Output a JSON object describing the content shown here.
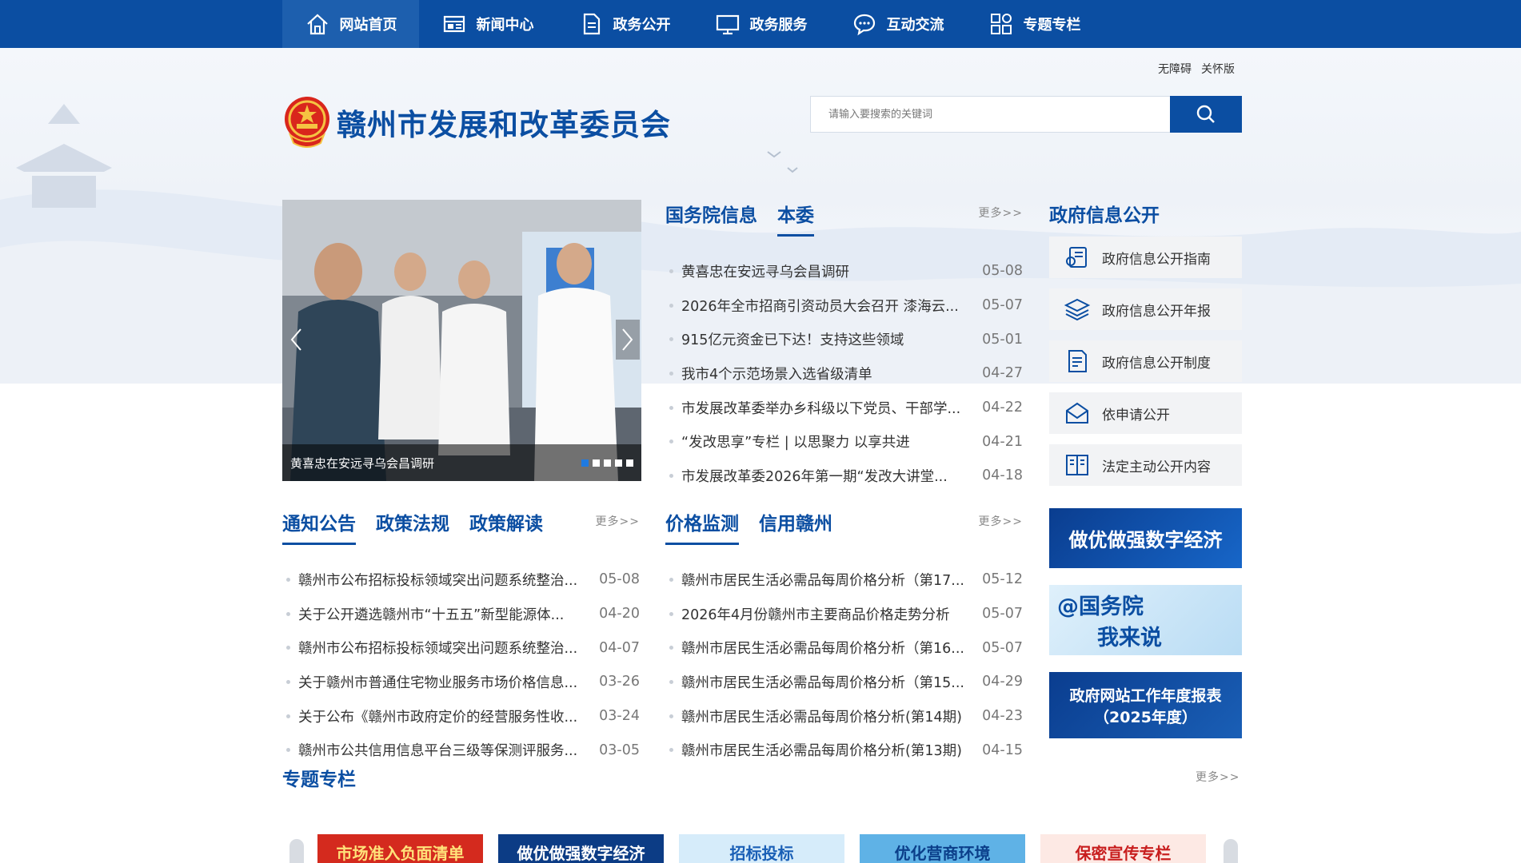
{
  "nav": {
    "items": [
      {
        "label": "网站首页",
        "icon": "home-icon"
      },
      {
        "label": "新闻中心",
        "icon": "newspaper-icon"
      },
      {
        "label": "政务公开",
        "icon": "document-icon"
      },
      {
        "label": "政务服务",
        "icon": "monitor-icon"
      },
      {
        "label": "互动交流",
        "icon": "chat-icon"
      },
      {
        "label": "专题专栏",
        "icon": "grid-icon"
      }
    ],
    "active_index": 0
  },
  "util": {
    "accessibility": "无障碍",
    "elderly": "关怀版"
  },
  "site": {
    "title": "赣州市发展和改革委员会"
  },
  "search": {
    "placeholder": "请输入要搜索的关键词"
  },
  "carousel": {
    "caption": "黄喜忠在安远寻乌会昌调研",
    "dot_count": 5,
    "active_dot": 0
  },
  "news1": {
    "tabs": [
      "国务院信息",
      "本委"
    ],
    "active_tab": 1,
    "more": "更多>>",
    "items": [
      {
        "title": "黄喜忠在安远寻乌会昌调研",
        "date": "05-08"
      },
      {
        "title": "2026年全市招商引资动员大会召开 漆海云...",
        "date": "05-07"
      },
      {
        "title": "915亿元资金已下达！支持这些领域",
        "date": "05-01"
      },
      {
        "title": "我市4个示范场景入选省级清单",
        "date": "04-27"
      },
      {
        "title": "市发展改革委举办乡科级以下党员、干部学...",
        "date": "04-22"
      },
      {
        "title": "“发改思享”专栏 | 以思聚力 以享共进",
        "date": "04-21"
      },
      {
        "title": "市发展改革委2026年第一期“发改大讲堂...",
        "date": "04-18"
      }
    ]
  },
  "gov_open": {
    "title": "政府信息公开",
    "items": [
      {
        "label": "政府信息公开指南",
        "icon": "guide-icon"
      },
      {
        "label": "政府信息公开年报",
        "icon": "layers-icon"
      },
      {
        "label": "政府信息公开制度",
        "icon": "rules-icon"
      },
      {
        "label": "依申请公开",
        "icon": "mail-icon"
      },
      {
        "label": "法定主动公开内容",
        "icon": "book-icon"
      }
    ]
  },
  "news2": {
    "tabs": [
      "通知公告",
      "政策法规",
      "政策解读"
    ],
    "active_tab": 0,
    "more": "更多>>",
    "items": [
      {
        "title": "赣州市公布招标投标领域突出问题系统整治...",
        "date": "05-08"
      },
      {
        "title": "关于公开遴选赣州市“十五五”新型能源体...",
        "date": "04-20"
      },
      {
        "title": "赣州市公布招标投标领域突出问题系统整治...",
        "date": "04-07"
      },
      {
        "title": "关于赣州市普通住宅物业服务市场价格信息...",
        "date": "03-26"
      },
      {
        "title": "关于公布《赣州市政府定价的经营服务性收...",
        "date": "03-24"
      },
      {
        "title": "赣州市公共信用信息平台三级等保测评服务...",
        "date": "03-05"
      }
    ]
  },
  "news3": {
    "tabs": [
      "价格监测",
      "信用赣州"
    ],
    "active_tab": 0,
    "more": "更多>>",
    "items": [
      {
        "title": "赣州市居民生活必需品每周价格分析（第17...",
        "date": "05-12"
      },
      {
        "title": "2026年4月份赣州市主要商品价格走势分析",
        "date": "05-07"
      },
      {
        "title": "赣州市居民生活必需品每周价格分析（第16...",
        "date": "05-07"
      },
      {
        "title": "赣州市居民生活必需品每周价格分析（第15...",
        "date": "04-29"
      },
      {
        "title": "赣州市居民生活必需品每周价格分析(第14期)",
        "date": "04-23"
      },
      {
        "title": "赣州市居民生活必需品每周价格分析(第13期)",
        "date": "04-15"
      }
    ]
  },
  "banners": {
    "digital": "做优做强数字经济",
    "state_council_line1": "@国务院",
    "state_council_line2": "我来说",
    "annual_report_line1": "政府网站工作年度报表",
    "annual_report_line2": "（2025年度）"
  },
  "special": {
    "title": "专题专栏",
    "more": "更多>>",
    "cards": [
      "市场准入负面清单",
      "做优做强数字经济",
      "招标投标",
      "优化营商环境",
      "保密宣传专栏"
    ]
  },
  "colors": {
    "brand": "#0b4ea2",
    "nav_active": "#1d5fae"
  }
}
